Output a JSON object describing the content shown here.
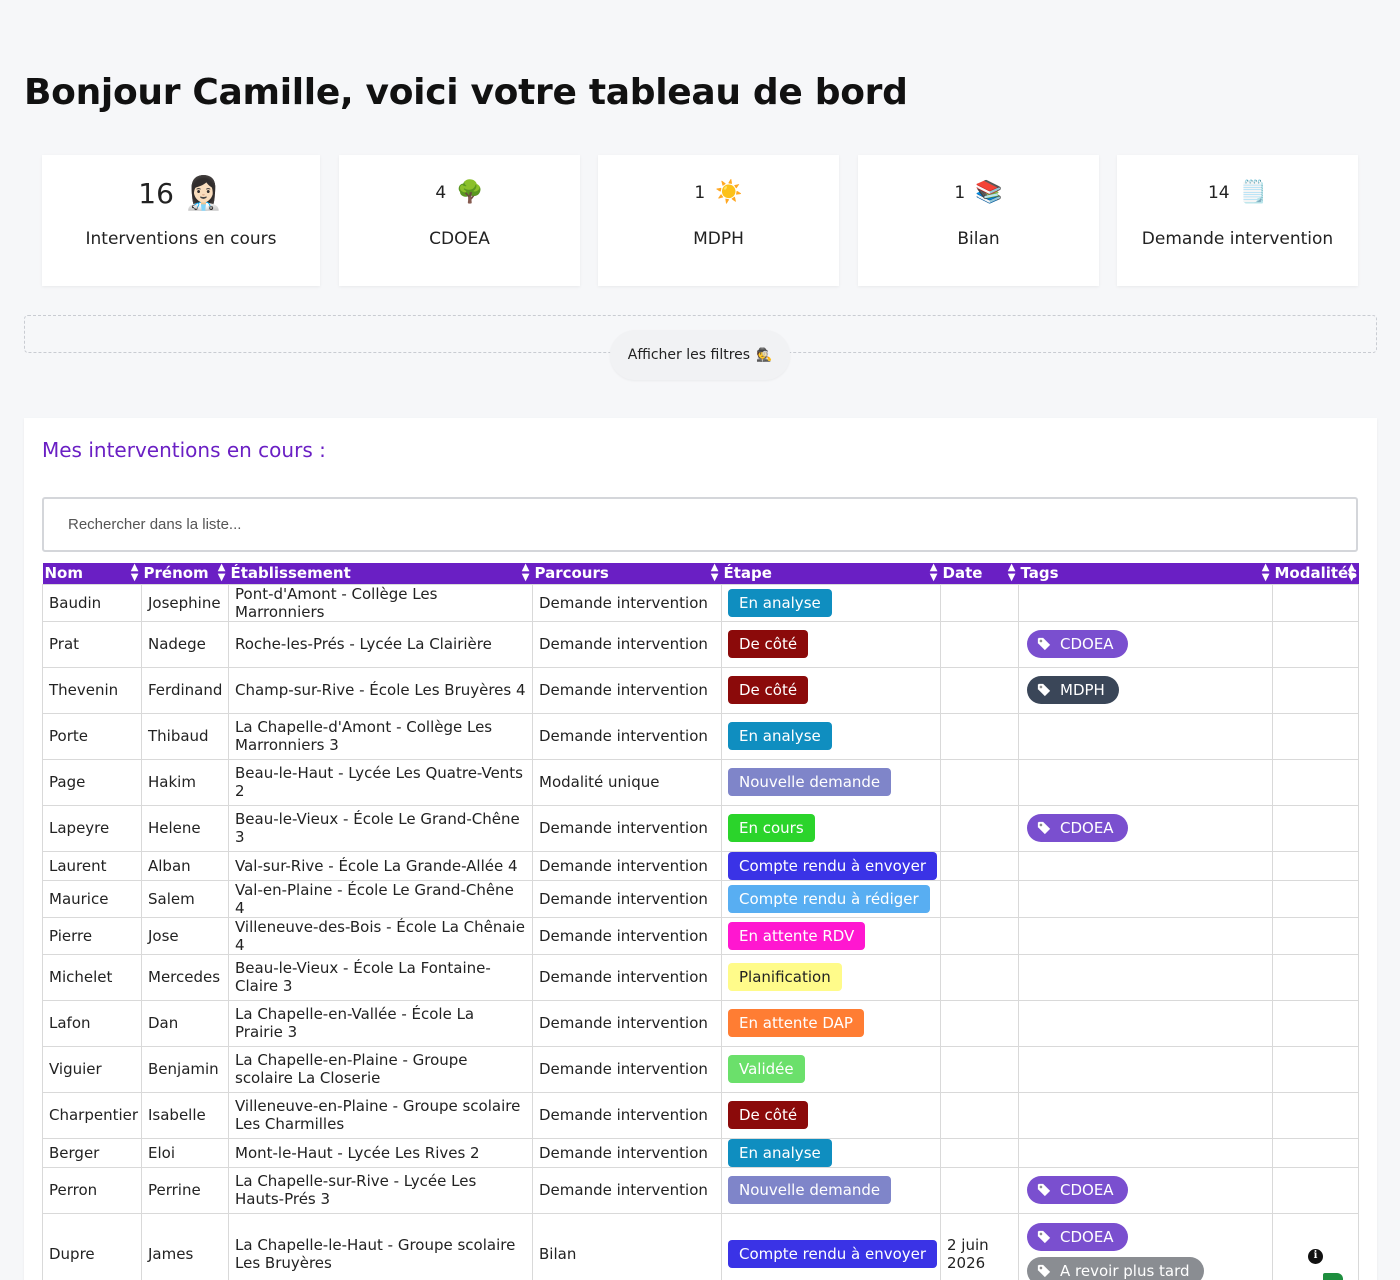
{
  "page": {
    "title": "Bonjour Camille, voici votre tableau de bord"
  },
  "stats": [
    {
      "count": "16",
      "emoji": "👩🏻‍⚕️",
      "label": "Interventions en cours"
    },
    {
      "count": "4",
      "emoji": "🌳",
      "label": "CDOEA"
    },
    {
      "count": "1",
      "emoji": "☀️",
      "label": "MDPH"
    },
    {
      "count": "1",
      "emoji": "📚",
      "label": "Bilan"
    },
    {
      "count": "14",
      "emoji": "🗒️",
      "label": "Demande intervention"
    }
  ],
  "filters": {
    "button_label": "Afficher les filtres",
    "button_emoji": "🕵️"
  },
  "section": {
    "title": "Mes interventions en cours :"
  },
  "search": {
    "placeholder": "Rechercher dans la liste..."
  },
  "columns": [
    "Nom",
    "Prénom",
    "Établissement",
    "Parcours",
    "Étape",
    "Date",
    "Tags",
    "Modalités"
  ],
  "colors": {
    "accent": "#6a1fc4",
    "etape": {
      "En analyse": "#0f8ec0",
      "De côté": "#8b0a0a",
      "Nouvelle demande": "#7f85c9",
      "En cours": "#2bd42b",
      "Compte rendu à envoyer": "#3a33e6",
      "Compte rendu à rédiger": "#58aef2",
      "En attente RDV": "#ff17d0",
      "Planification": "#fffb8a",
      "En attente DAP": "#ff7d33",
      "Validée": "#6be06b"
    },
    "tags": {
      "CDOEA": "#7a4fcf",
      "MDPH": "#3a4658",
      "A revoir plus tard": "#8a8d92"
    }
  },
  "rows": [
    {
      "nom": "Baudin",
      "prenom": "Josephine",
      "etablissement": "Pont-d'Amont - Collège Les Marronniers",
      "parcours": "Demande intervention",
      "etape": "En analyse",
      "date": "",
      "tags": [],
      "modalites": ""
    },
    {
      "nom": "Prat",
      "prenom": "Nadege",
      "etablissement": "Roche-les-Prés - Lycée La Clairière",
      "parcours": "Demande intervention",
      "etape": "De côté",
      "date": "",
      "tags": [
        "CDOEA"
      ],
      "modalites": ""
    },
    {
      "nom": "Thevenin",
      "prenom": "Ferdinand",
      "etablissement": "Champ-sur-Rive - École Les Bruyères 4",
      "parcours": "Demande intervention",
      "etape": "De côté",
      "date": "",
      "tags": [
        "MDPH"
      ],
      "modalites": ""
    },
    {
      "nom": "Porte",
      "prenom": "Thibaud",
      "etablissement": "La Chapelle-d'Amont - Collège Les Marronniers 3",
      "parcours": "Demande intervention",
      "etape": "En analyse",
      "date": "",
      "tags": [],
      "modalites": ""
    },
    {
      "nom": "Page",
      "prenom": "Hakim",
      "etablissement": "Beau-le-Haut - Lycée Les Quatre-Vents 2",
      "parcours": "Modalité unique",
      "etape": "Nouvelle demande",
      "date": "",
      "tags": [],
      "modalites": ""
    },
    {
      "nom": "Lapeyre",
      "prenom": "Helene",
      "etablissement": "Beau-le-Vieux - École Le Grand-Chêne 3",
      "parcours": "Demande intervention",
      "etape": "En cours",
      "date": "",
      "tags": [
        "CDOEA"
      ],
      "modalites": ""
    },
    {
      "nom": "Laurent",
      "prenom": "Alban",
      "etablissement": "Val-sur-Rive - École La Grande-Allée 4",
      "parcours": "Demande intervention",
      "etape": "Compte rendu à envoyer",
      "date": "",
      "tags": [],
      "modalites": ""
    },
    {
      "nom": "Maurice",
      "prenom": "Salem",
      "etablissement": "Val-en-Plaine - École Le Grand-Chêne 4",
      "parcours": "Demande intervention",
      "etape": "Compte rendu à rédiger",
      "date": "",
      "tags": [],
      "modalites": ""
    },
    {
      "nom": "Pierre",
      "prenom": "Jose",
      "etablissement": "Villeneuve-des-Bois - École La Chênaie 4",
      "parcours": "Demande intervention",
      "etape": "En attente RDV",
      "date": "",
      "tags": [],
      "modalites": ""
    },
    {
      "nom": "Michelet",
      "prenom": "Mercedes",
      "etablissement": "Beau-le-Vieux - École La Fontaine-Claire 3",
      "parcours": "Demande intervention",
      "etape": "Planification",
      "date": "",
      "tags": [],
      "modalites": ""
    },
    {
      "nom": "Lafon",
      "prenom": "Dan",
      "etablissement": "La Chapelle-en-Vallée - École La Prairie 3",
      "parcours": "Demande intervention",
      "etape": "En attente DAP",
      "date": "",
      "tags": [],
      "modalites": ""
    },
    {
      "nom": "Viguier",
      "prenom": "Benjamin",
      "etablissement": "La Chapelle-en-Plaine - Groupe scolaire La Closerie",
      "parcours": "Demande intervention",
      "etape": "Validée",
      "date": "",
      "tags": [],
      "modalites": ""
    },
    {
      "nom": "Charpentier",
      "prenom": "Isabelle",
      "etablissement": "Villeneuve-en-Plaine - Groupe scolaire Les Charmilles",
      "parcours": "Demande intervention",
      "etape": "De côté",
      "date": "",
      "tags": [],
      "modalites": ""
    },
    {
      "nom": "Berger",
      "prenom": "Eloi",
      "etablissement": "Mont-le-Haut - Lycée Les Rives 2",
      "parcours": "Demande intervention",
      "etape": "En analyse",
      "date": "",
      "tags": [],
      "modalites": ""
    },
    {
      "nom": "Perron",
      "prenom": "Perrine",
      "etablissement": "La Chapelle-sur-Rive - Lycée Les Hauts-Prés 3",
      "parcours": "Demande intervention",
      "etape": "Nouvelle demande",
      "date": "",
      "tags": [
        "CDOEA"
      ],
      "modalites": ""
    },
    {
      "nom": "Dupre",
      "prenom": "James",
      "etablissement": "La Chapelle-le-Haut - Groupe scolaire Les Bruyères",
      "parcours": "Bilan",
      "etape": "Compte rendu à envoyer",
      "date": "2 juin 2026",
      "tags": [
        "CDOEA",
        "A revoir plus tard"
      ],
      "modalites": "info"
    }
  ]
}
